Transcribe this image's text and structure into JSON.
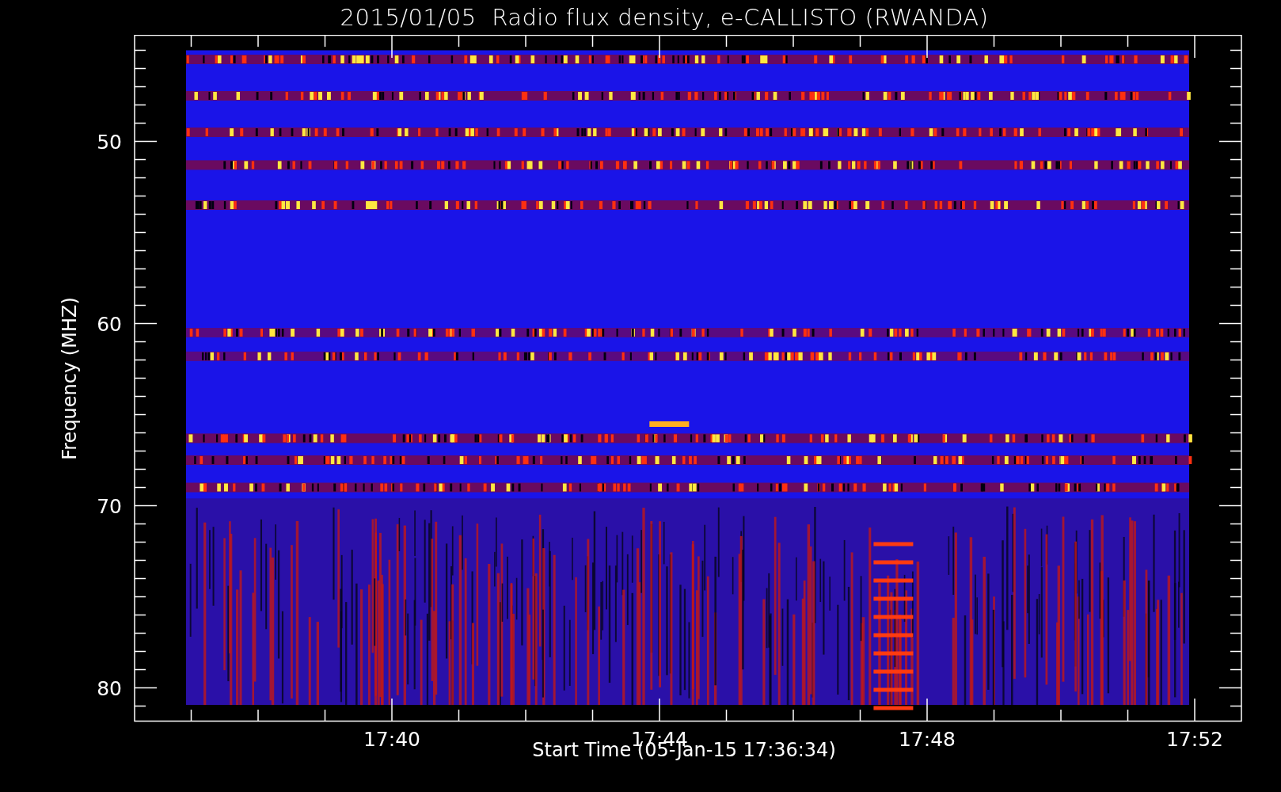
{
  "title": "2015/01/05  Radio flux density, e-CALLISTO (RWANDA)",
  "y_axis": {
    "label": "Frequency (MHZ)",
    "ticks": [
      "50",
      "60",
      "70",
      "80"
    ]
  },
  "x_axis": {
    "label": "Start Time (05-Jan-15 17:36:34)",
    "ticks": [
      "17:40",
      "17:44",
      "17:48",
      "17:52"
    ]
  }
}
